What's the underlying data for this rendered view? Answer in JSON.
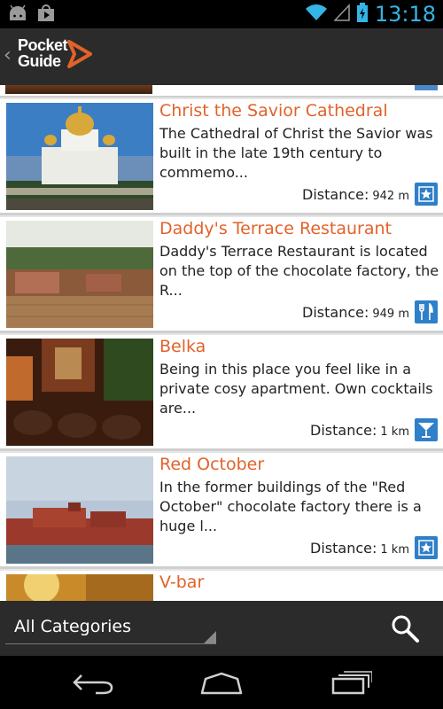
{
  "status": {
    "time": "13:18"
  },
  "app": {
    "logo_line1": "Pocket",
    "logo_line2": "Guide"
  },
  "items": [
    {
      "title": "Christ the Savior Cathedral",
      "description": "The Cathedral of Christ the Savior was built in the late 19th century to commemo...",
      "distance_label": "Distance:",
      "distance_value": "942 m",
      "category_icon": "star-icon"
    },
    {
      "title": "Daddy's Terrace Restaurant",
      "description": "Daddy's Terrace Restaurant is located on the top of the chocolate factory, the R...",
      "distance_label": "Distance:",
      "distance_value": "949 m",
      "category_icon": "fork-knife-icon"
    },
    {
      "title": "Belka",
      "description": "Being in this place you feel like in a private cosy apartment. Own cocktails are...",
      "distance_label": "Distance:",
      "distance_value": "1 km",
      "category_icon": "cocktail-icon"
    },
    {
      "title": "Red October",
      "description": "In the former buildings of the \"Red October\" chocolate factory there is a huge l...",
      "distance_label": "Distance:",
      "distance_value": "1 km",
      "category_icon": "star-icon"
    },
    {
      "title": "V-bar",
      "description": "",
      "distance_label": "",
      "distance_value": "",
      "category_icon": ""
    }
  ],
  "filter": {
    "category": "All Categories"
  },
  "colors": {
    "accent": "#e2622a",
    "status_blue": "#35b5e5",
    "icon_blue": "#2f7fc9"
  }
}
